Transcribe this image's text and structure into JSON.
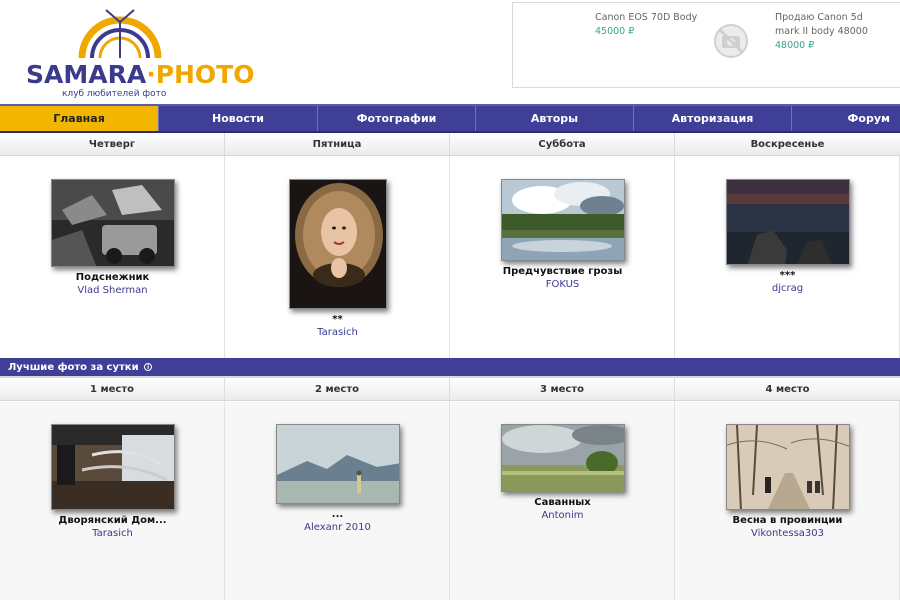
{
  "site": {
    "logo_main": "SAMARA",
    "logo_dot": "·",
    "logo_photo": "PHOTO",
    "logo_subtitle": "клуб любителей фото",
    "logo_colors": {
      "primary": "#3b3a8e",
      "accent": "#f0a800"
    }
  },
  "ads": [
    {
      "title": "Canon EOS 70D Body",
      "price": "45000 ₽"
    },
    {
      "title": "Продаю Canon 5d mark II body 48000",
      "price": "48000 ₽"
    }
  ],
  "ad_icon": "no-camera-icon",
  "nav": [
    {
      "label": "Главная",
      "active": true
    },
    {
      "label": "Новости"
    },
    {
      "label": "Фотографии"
    },
    {
      "label": "Авторы"
    },
    {
      "label": "Авторизация"
    },
    {
      "label": "Форум"
    }
  ],
  "days": {
    "columns": [
      {
        "day": "Четверг",
        "title": "Подснежник",
        "author": "Vlad Sherman"
      },
      {
        "day": "Пятница",
        "title": "**",
        "author": "Tarasich"
      },
      {
        "day": "Суббота",
        "title": "Предчувствие грозы",
        "author": "FOKUS"
      },
      {
        "day": "Воскресенье",
        "title": "***",
        "author": "djcrag"
      }
    ]
  },
  "best": {
    "heading": "Лучшие фото за сутки",
    "heading_icon": "info-icon",
    "columns": [
      {
        "place": "1 место",
        "title": "Дворянский Дом...",
        "author": "Tarasich"
      },
      {
        "place": "2 место",
        "title": "...",
        "author": "Alexanr 2010"
      },
      {
        "place": "3 место",
        "title": "Саванных",
        "author": "Antonim"
      },
      {
        "place": "4 место",
        "title": "Весна в провинции",
        "author": "Vikontessa303"
      }
    ]
  }
}
